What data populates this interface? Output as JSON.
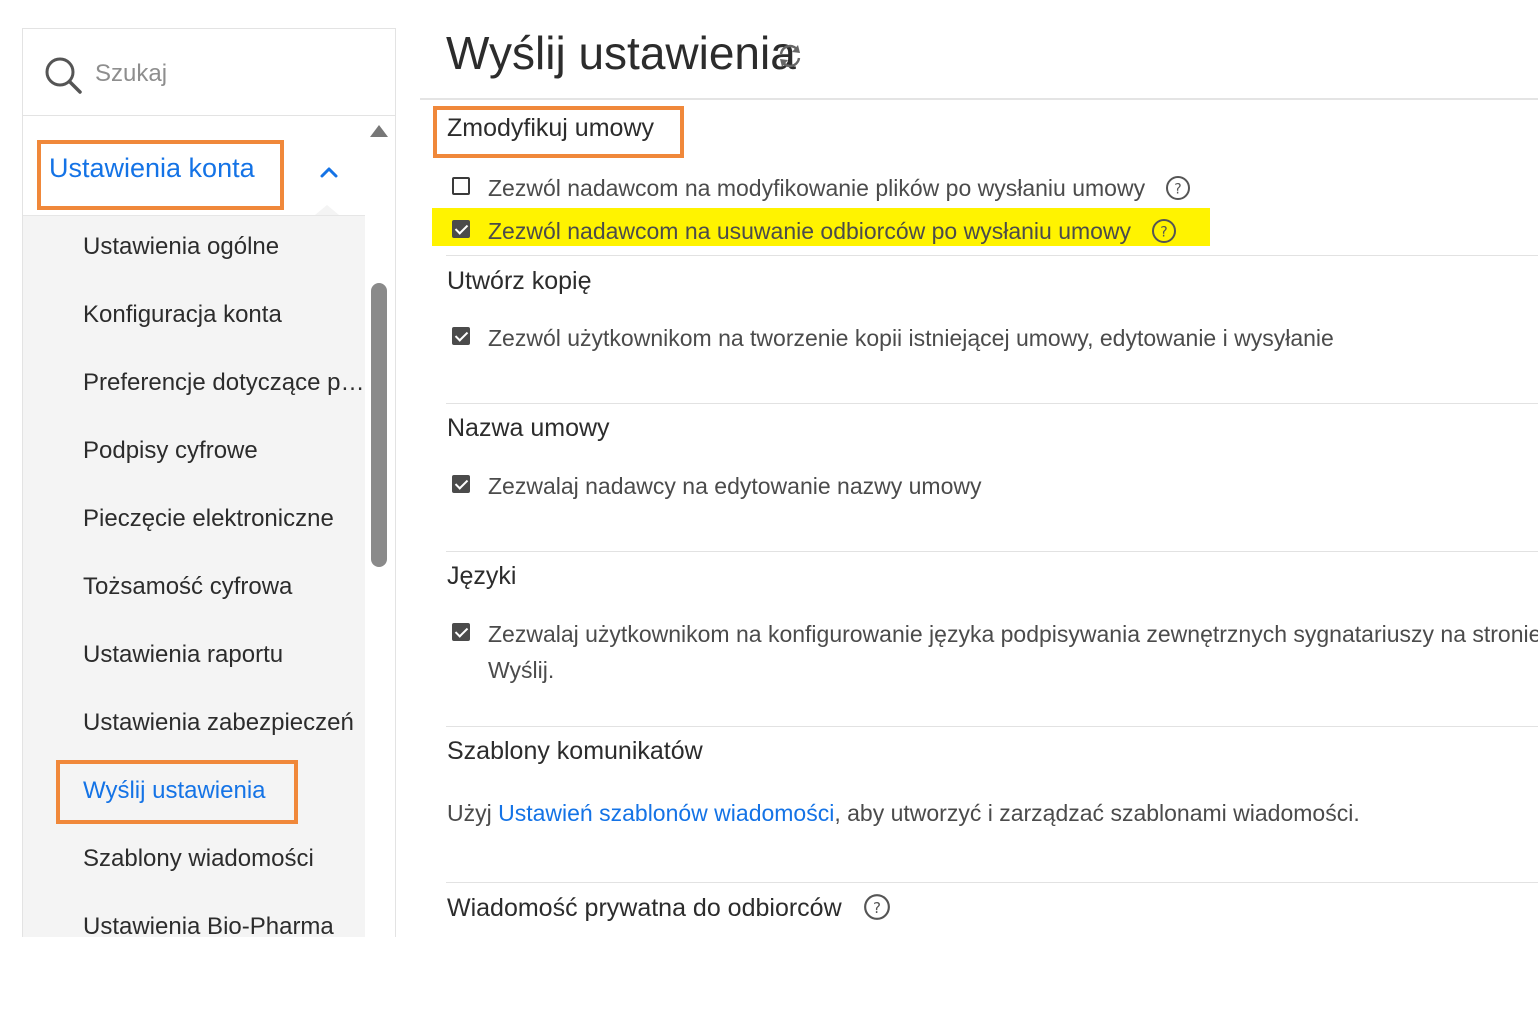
{
  "search": {
    "placeholder": "Szukaj"
  },
  "sidebar": {
    "section_label": "Ustawienia konta",
    "items": [
      {
        "label": "Ustawienia ogólne",
        "active": false
      },
      {
        "label": "Konfiguracja konta",
        "active": false
      },
      {
        "label": "Preferencje dotyczące po...",
        "active": false
      },
      {
        "label": "Podpisy cyfrowe",
        "active": false
      },
      {
        "label": "Pieczęcie elektroniczne",
        "active": false
      },
      {
        "label": "Tożsamość cyfrowa",
        "active": false
      },
      {
        "label": "Ustawienia raportu",
        "active": false
      },
      {
        "label": "Ustawienia zabezpieczeń",
        "active": false
      },
      {
        "label": "Wyślij ustawienia",
        "active": true
      },
      {
        "label": "Szablony wiadomości",
        "active": false
      },
      {
        "label": "Ustawienia Bio-Pharma",
        "active": false
      }
    ]
  },
  "main": {
    "title": "Wyślij ustawienia",
    "sections": [
      {
        "title": "Zmodyfikuj umowy",
        "options": [
          {
            "label": "Zezwól nadawcom na modyfikowanie plików po wysłaniu umowy",
            "checked": false,
            "help": true
          },
          {
            "label": "Zezwól nadawcom na usuwanie odbiorców po wysłaniu umowy",
            "checked": true,
            "help": true,
            "highlighted": true
          }
        ]
      },
      {
        "title": "Utwórz kopię",
        "options": [
          {
            "label": "Zezwól użytkownikom na tworzenie kopii istniejącej umowy, edytowanie i wysyłanie",
            "checked": true
          }
        ]
      },
      {
        "title": "Nazwa umowy",
        "options": [
          {
            "label": "Zezwalaj nadawcy na edytowanie nazwy umowy",
            "checked": true
          }
        ]
      },
      {
        "title": "Języki",
        "options": [
          {
            "label": "Zezwalaj użytkownikom na konfigurowanie języka podpisywania zewnętrznych sygnatariuszy na stronie",
            "label_line2": "Wyślij.",
            "checked": true
          }
        ]
      },
      {
        "title": "Szablony komunikatów",
        "text_before": "Użyj ",
        "link": "Ustawień szablonów wiadomości",
        "text_after": ", aby utworzyć i zarządzać szablonami wiadomości."
      },
      {
        "title": "Wiadomość prywatna do odbiorców",
        "help": true
      }
    ]
  },
  "colors": {
    "accent": "#1473e6",
    "highlight_box": "#f0883a",
    "highlight_fill": "#fff300"
  }
}
